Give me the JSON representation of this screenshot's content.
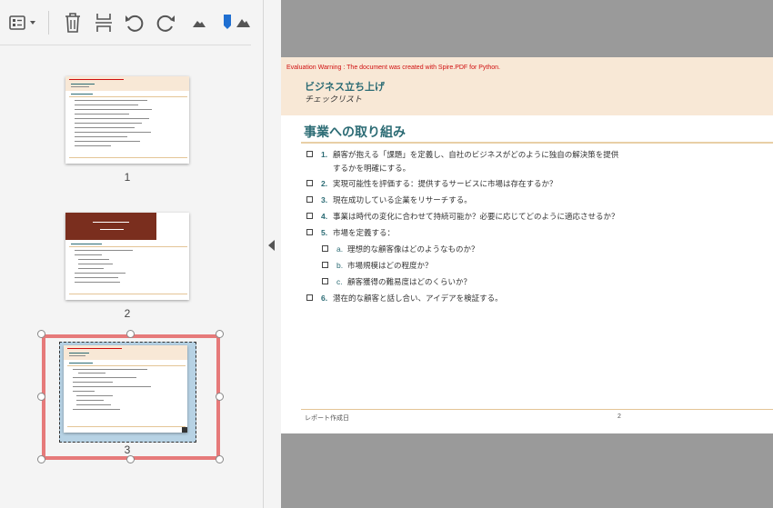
{
  "thumbnails": [
    {
      "label": "1"
    },
    {
      "label": "2"
    },
    {
      "label": "3"
    }
  ],
  "document": {
    "warning": "Evaluation Warning : The document was created with Spire.PDF for Python.",
    "title": "ビジネス立ち上げ",
    "subtitle": "チェックリスト",
    "section_heading": "事業への取り組み",
    "items": [
      {
        "num": "1.",
        "text": "顧客が抱える「課題」を定義し、自社のビジネスがどのように独自の解決策を提供",
        "text2": "するかを明確にする。"
      },
      {
        "num": "2.",
        "text": "実現可能性を評価する：提供するサービスに市場は存在するか？"
      },
      {
        "num": "3.",
        "text": "現在成功している企業をリサーチする。"
      },
      {
        "num": "4.",
        "text": "事業は時代の変化に合わせて持続可能か？必要に応じてどのように適応させるか？"
      },
      {
        "num": "5.",
        "text": "市場を定義する："
      },
      {
        "num": "a.",
        "text": "理想的な顧客像はどのようなものか？"
      },
      {
        "num": "b.",
        "text": "市場規模はどの程度か？"
      },
      {
        "num": "c.",
        "text": "顧客獲得の難易度はどのくらいか？"
      },
      {
        "num": "6.",
        "text": "潜在的な顧客と話し合い、アイデアを検証する。"
      }
    ],
    "footer_left": "レポート作成日",
    "footer_page": "2"
  },
  "colors": {
    "accent": "#2b6b74",
    "header_band": "#f8e8d6",
    "warning": "#d01010",
    "selection": "#e67a7a"
  }
}
